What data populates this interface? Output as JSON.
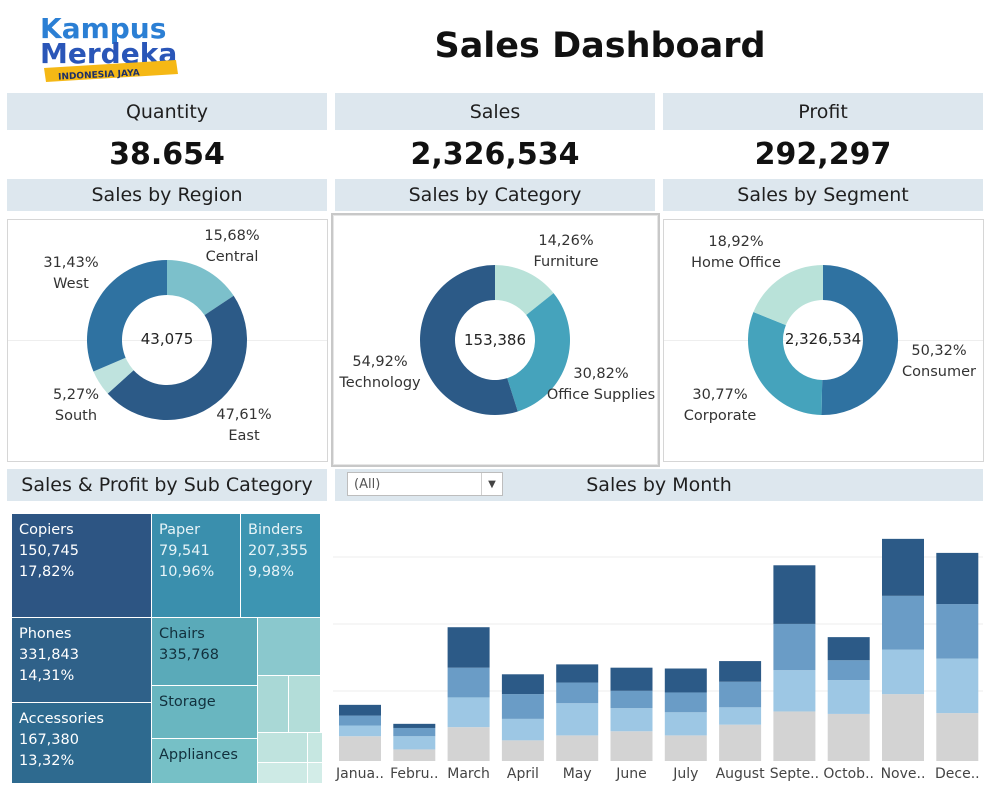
{
  "logo": {
    "line1": "Kampus",
    "line2": "Merdeka",
    "tagline": "INDONESIA JAYA"
  },
  "title": "Sales Dashboard",
  "kpis": [
    {
      "label": "Quantity",
      "value": "38.654"
    },
    {
      "label": "Sales",
      "value": "2,326,534"
    },
    {
      "label": "Profit",
      "value": "292,297"
    }
  ],
  "region": {
    "header": "Sales by Region",
    "center": "43,075",
    "slices": [
      {
        "name": "Central",
        "pct": "15,68%",
        "share": 15.68,
        "color": "#7cc0cb"
      },
      {
        "name": "East",
        "pct": "47,61%",
        "share": 47.61,
        "color": "#2c5a87"
      },
      {
        "name": "South",
        "pct": "5,27%",
        "share": 5.27,
        "color": "#bfe3de"
      },
      {
        "name": "West",
        "pct": "31,43%",
        "share": 31.43,
        "color": "#2f72a1"
      }
    ]
  },
  "category": {
    "header": "Sales by Category",
    "center": "153,386",
    "slices": [
      {
        "name": "Furniture",
        "pct": "14,26%",
        "share": 14.26,
        "color": "#b9e2d9"
      },
      {
        "name": "Office Supplies",
        "pct": "30,82%",
        "share": 30.82,
        "color": "#45a3bc"
      },
      {
        "name": "Technology",
        "pct": "54,92%",
        "share": 54.92,
        "color": "#2c5a87"
      }
    ]
  },
  "segment": {
    "header": "Sales by Segment",
    "center": "2,326,534",
    "slices": [
      {
        "name": "Consumer",
        "pct": "50,32%",
        "share": 50.32,
        "color": "#2f72a1"
      },
      {
        "name": "Corporate",
        "pct": "30,77%",
        "share": 30.77,
        "color": "#45a3bc"
      },
      {
        "name": "Home Office",
        "pct": "18,92%",
        "share": 18.92,
        "color": "#b9e2d9"
      }
    ]
  },
  "subcat": {
    "header": "Sales & Profit by Sub Category",
    "tiles": [
      {
        "name": "Copiers",
        "value": "150,745",
        "pct": "17,82%"
      },
      {
        "name": "Paper",
        "value": "79,541",
        "pct": "10,96%"
      },
      {
        "name": "Binders",
        "value": "207,355",
        "pct": "9,98%"
      },
      {
        "name": "Phones",
        "value": "331,843",
        "pct": "14,31%"
      },
      {
        "name": "Chairs",
        "value": "335,768",
        "pct": ""
      },
      {
        "name": "Storage",
        "value": "",
        "pct": ""
      },
      {
        "name": "Accessories",
        "value": "167,380",
        "pct": "13,32%"
      },
      {
        "name": "Appliances",
        "value": "",
        "pct": ""
      }
    ]
  },
  "month": {
    "header": "Sales by Month",
    "filter": "(All)",
    "categories": [
      "Janua..",
      "Febru..",
      "March",
      "April",
      "May",
      "June",
      "July",
      "August",
      "Septe..",
      "Octob..",
      "Nove..",
      "Dece.."
    ],
    "colors": [
      "#d3d3d3",
      "#9dc7e4",
      "#6a9cc6",
      "#2c5a87"
    ],
    "chart_data": {
      "type": "bar",
      "stacked": true,
      "categories": [
        "January",
        "February",
        "March",
        "April",
        "May",
        "June",
        "July",
        "August",
        "September",
        "October",
        "November",
        "December"
      ],
      "series": [
        {
          "values": [
            30,
            14,
            41,
            25,
            31,
            36,
            31,
            44,
            60,
            57,
            81,
            58
          ]
        },
        {
          "values": [
            13,
            16,
            36,
            26,
            39,
            28,
            28,
            21,
            50,
            41,
            54,
            66
          ]
        },
        {
          "values": [
            12,
            10,
            36,
            30,
            25,
            21,
            24,
            31,
            56,
            24,
            65,
            66
          ]
        },
        {
          "values": [
            13,
            5,
            49,
            24,
            22,
            28,
            29,
            25,
            71,
            28,
            69,
            62
          ]
        }
      ],
      "ylim": [
        0,
        310
      ]
    }
  }
}
